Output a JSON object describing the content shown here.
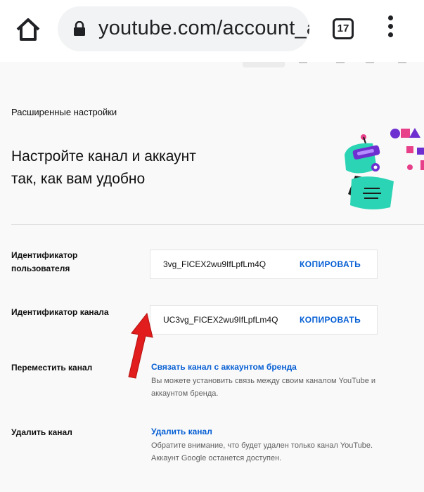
{
  "browser": {
    "url": "youtube.com/account_a",
    "tab_count": "17"
  },
  "page": {
    "section_title": "Расширенные настройки",
    "headline": "Настройте канал и аккаунт так, как вам удобно",
    "user_id": {
      "label": "Идентификатор пользователя",
      "value": "3vg_FICEX2wu9IfLpfLm4Q",
      "copy_label": "КОПИРОВАТЬ"
    },
    "channel_id": {
      "label": "Идентификатор канала",
      "value": "UC3vg_FICEX2wu9IfLpfLm4Q",
      "copy_label": "КОПИРОВАТЬ"
    },
    "move_channel": {
      "label": "Переместить канал",
      "link": "Связать канал с аккаунтом бренда",
      "description_line1": "Вы можете установить связь между своим каналом YouTube и",
      "description_line2": "аккаунтом бренда."
    },
    "delete_channel": {
      "label": "Удалить канал",
      "link": "Удалить канал",
      "description_line1": "Обратите внимание, что будет удален только канал YouTube.",
      "description_line2": "Аккаунт Google останется доступен."
    }
  },
  "colors": {
    "link_blue": "#065fd4",
    "arrow_red": "#e11d1d",
    "robot_teal": "#2bd4b4",
    "robot_purple": "#6e2fd0"
  }
}
